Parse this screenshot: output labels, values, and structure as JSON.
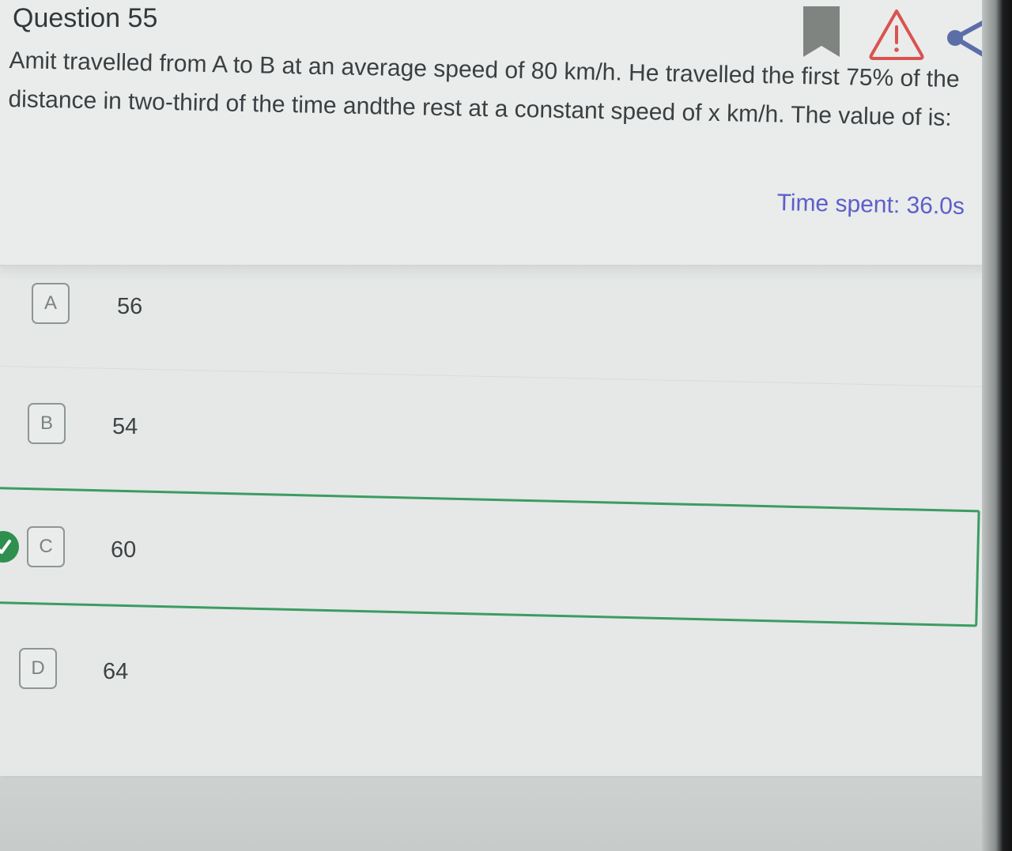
{
  "question": {
    "number_label": "Question 55",
    "text": "Amit travelled from A to B at an average speed of 80 km/h. He travelled the first 75% of the distance in two-third of the time andthe rest at a constant speed of x km/h. The value of is:",
    "time_spent": "Time spent: 36.0s"
  },
  "toolbar": {
    "icons": [
      "bookmark-icon",
      "report-warning-icon",
      "share-icon"
    ],
    "warning_color": "#d9534f",
    "bookmark_color": "#7f8480",
    "share_color": "#5b6ea8"
  },
  "options": [
    {
      "letter": "A",
      "value": "56"
    },
    {
      "letter": "B",
      "value": "54"
    },
    {
      "letter": "C",
      "value": "60",
      "selected": true,
      "correct": true
    },
    {
      "letter": "D",
      "value": "64"
    }
  ],
  "colors": {
    "accent_time": "#5e5fc8",
    "correct_green": "#3c9c63"
  }
}
